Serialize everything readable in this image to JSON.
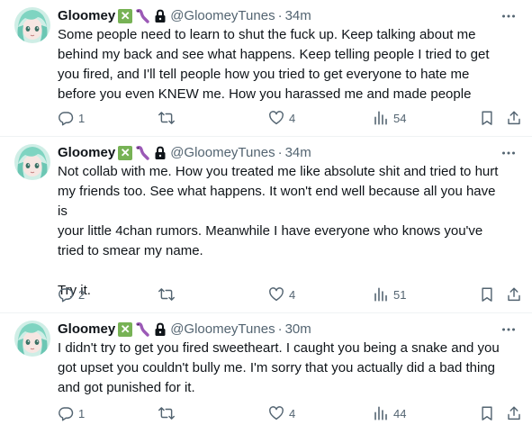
{
  "tweets": [
    {
      "name": "Gloomey",
      "handle": "@GloomeyTunes",
      "separator": "·",
      "time": "34m",
      "text": "Some people need to learn to shut the fuck up. Keep talking about me\nbehind my back and see what happens. Keep telling people I tried to get\nyou fired, and I'll tell people how you tried to get everyone to hate me\nbefore you even KNEW me. How you harassed me and made people",
      "replies": "1",
      "retweets": "",
      "likes": "4",
      "views": "54"
    },
    {
      "name": "Gloomey",
      "handle": "@GloomeyTunes",
      "separator": "·",
      "time": "34m",
      "text": "Not collab with me. How you treated me like absolute shit and tried to hurt\nmy friends too. See what happens. It won't end well because all you have is\nyour little 4chan rumors. Meanwhile I have everyone who knows you've\ntried to smear my name.\n\nTry it.",
      "replies": "2",
      "retweets": "",
      "likes": "4",
      "views": "51"
    },
    {
      "name": "Gloomey",
      "handle": "@GloomeyTunes",
      "separator": "·",
      "time": "30m",
      "text": "I didn't try to get you fired sweetheart. I caught you being a snake and you\ngot upset you couldn't bully me. I'm sorry that you actually did a bad thing\nand got punished for it.",
      "replies": "1",
      "retweets": "",
      "likes": "4",
      "views": "44"
    }
  ],
  "badge_emoji": "✕",
  "colors": {
    "text": "#0f1419",
    "secondary": "#536471",
    "divider": "#eff3f4",
    "check_emoji_bg": "#77b255",
    "worm": "#9b59b6",
    "avatar_hair": "#7fd4c1"
  },
  "icons": [
    "more-icon",
    "reply-icon",
    "retweet-icon",
    "like-icon",
    "views-icon",
    "bookmark-icon",
    "share-icon",
    "lock-icon",
    "worm-emoji-icon",
    "check-emoji-icon"
  ]
}
